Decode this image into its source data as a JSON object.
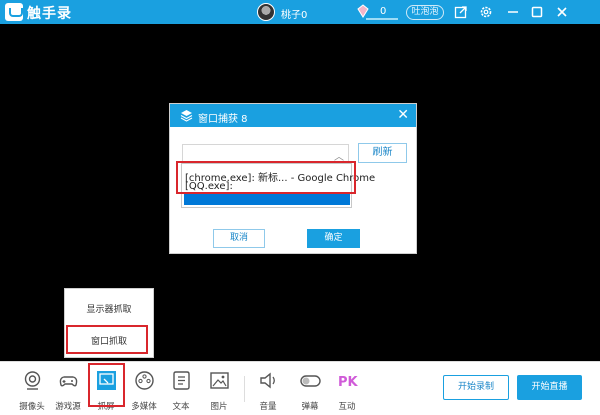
{
  "app": {
    "title": "触手录",
    "username": "桃子0",
    "coin_count": "0",
    "recharge_label": "吐泡泡"
  },
  "dialog": {
    "title": "窗口捕获 8",
    "refresh_label": "刷新",
    "cancel_label": "取消",
    "confirm_label": "确定",
    "dropdown_options": [
      "[chrome.exe]: 新标... - Google Chrome",
      "[QQ.exe]:"
    ]
  },
  "capture_menu": {
    "items": [
      "显示器抓取",
      "窗口抓取"
    ]
  },
  "toolbar": {
    "tools": [
      {
        "label": "摄像头",
        "icon": "camera-icon"
      },
      {
        "label": "游戏源",
        "icon": "gamepad-icon"
      },
      {
        "label": "抓屏",
        "icon": "screen-capture-icon"
      },
      {
        "label": "多媒体",
        "icon": "multimedia-icon"
      },
      {
        "label": "文本",
        "icon": "text-icon"
      },
      {
        "label": "图片",
        "icon": "image-icon"
      },
      {
        "label": "音量",
        "icon": "volume-icon"
      },
      {
        "label": "弹幕",
        "icon": "danmaku-toggle-icon"
      },
      {
        "label": "互动",
        "icon": "pk-icon"
      }
    ],
    "record_label": "开始录制",
    "live_label": "开始直播"
  },
  "colors": {
    "accent": "#1aa0e0",
    "highlight": "#d9262c",
    "selection": "#0078d7"
  }
}
